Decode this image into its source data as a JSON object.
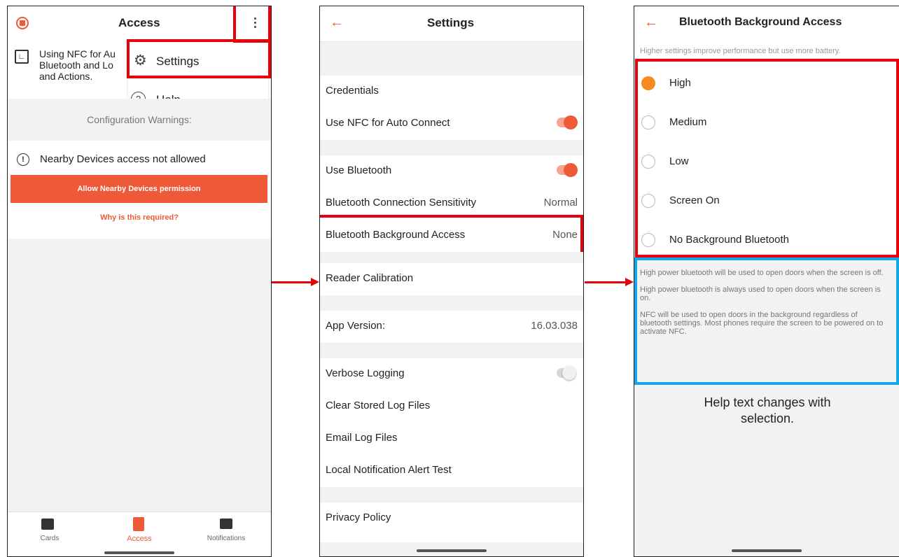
{
  "screen1": {
    "title": "Access",
    "menu": {
      "settings": "Settings",
      "help": "Help"
    },
    "nfc_text_lines": [
      "Using NFC for Au",
      "Bluetooth and Lo",
      "and Actions."
    ],
    "config_warnings": "Configuration Warnings:",
    "warning": "Nearby Devices access not allowed",
    "allow_button": "Allow Nearby Devices permission",
    "why_link": "Why is this required?",
    "nav": [
      {
        "label": "Cards",
        "icon": "cards-icon"
      },
      {
        "label": "Access",
        "icon": "door-icon"
      },
      {
        "label": "Notifications",
        "icon": "chat-icon"
      }
    ]
  },
  "screen2": {
    "title": "Settings",
    "credentials": "Credentials",
    "use_nfc": "Use NFC for Auto Connect",
    "use_bluetooth": "Use Bluetooth",
    "bt_sensitivity": {
      "label": "Bluetooth Connection Sensitivity",
      "value": "Normal"
    },
    "bt_background": {
      "label": "Bluetooth Background Access",
      "value": "None"
    },
    "reader_calibration": "Reader Calibration",
    "app_version": {
      "label": "App Version:",
      "value": "16.03.038"
    },
    "verbose_logging": "Verbose Logging",
    "clear_logs": "Clear Stored Log Files",
    "email_logs": "Email Log Files",
    "local_alert": "Local Notification Alert Test",
    "privacy": "Privacy Policy"
  },
  "screen3": {
    "title": "Bluetooth Background Access",
    "subtitle": "Higher settings improve performance but use more battery.",
    "options": [
      "High",
      "Medium",
      "Low",
      "Screen On",
      "No Background Bluetooth"
    ],
    "selected": "High",
    "help": [
      "High power bluetooth will be used to open doors when the screen is off.",
      "High power bluetooth is always used to open doors when the screen is on.",
      "NFC will be used to open doors in the background regardless of bluetooth settings. Most phones require the screen to be powered on to activate NFC."
    ]
  },
  "caption": "Help text changes with selection.",
  "colors": {
    "accent": "#ee5a38",
    "highlight_red": "#e8000b",
    "highlight_blue": "#13a9e6",
    "radio_selected": "#f58a1f"
  }
}
